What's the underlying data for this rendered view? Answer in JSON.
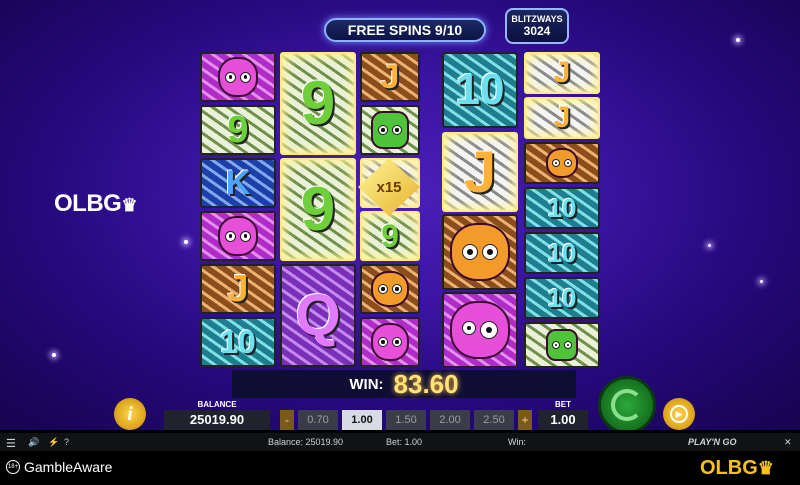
{
  "header": {
    "free_spins": "FREE SPINS 9/10",
    "blitzways_label": "BLITZWAYS",
    "blitzways_value": "3024"
  },
  "watermark": {
    "brand": "OLBG",
    "crown": "♛"
  },
  "reels": {
    "multiplier": "x15",
    "symbols": {
      "nine": "9",
      "ten": "10",
      "k": "K",
      "j": "J",
      "q": "Q"
    }
  },
  "win": {
    "label": "WIN:",
    "amount": "83.60"
  },
  "controls": {
    "info": "i",
    "balance_label": "BALANCE",
    "balance_value": "25019.90",
    "bet_label": "BET",
    "bet_value": "1.00",
    "bet_options": [
      "0.70",
      "1.00",
      "1.50",
      "2.00",
      "2.50"
    ],
    "selected_bet": "1.00",
    "minus": "-",
    "plus": "+"
  },
  "statusbar": {
    "balance": "Balance: 25019.90",
    "bet": "Bet: 1.00",
    "win": "Win:",
    "menu": "☰",
    "sound": "🔊",
    "settings": "⚡",
    "help": "?",
    "provider": "PLAY'N GO",
    "close": "✕"
  },
  "footer": {
    "gambleaware": "GambleAware",
    "age": "18+",
    "brand": "OLBG",
    "crown": "♛"
  },
  "colors": {
    "accent_gold": "#ffe27a",
    "spin_green": "#2fa83a",
    "background_purple": "#3a14a0"
  }
}
